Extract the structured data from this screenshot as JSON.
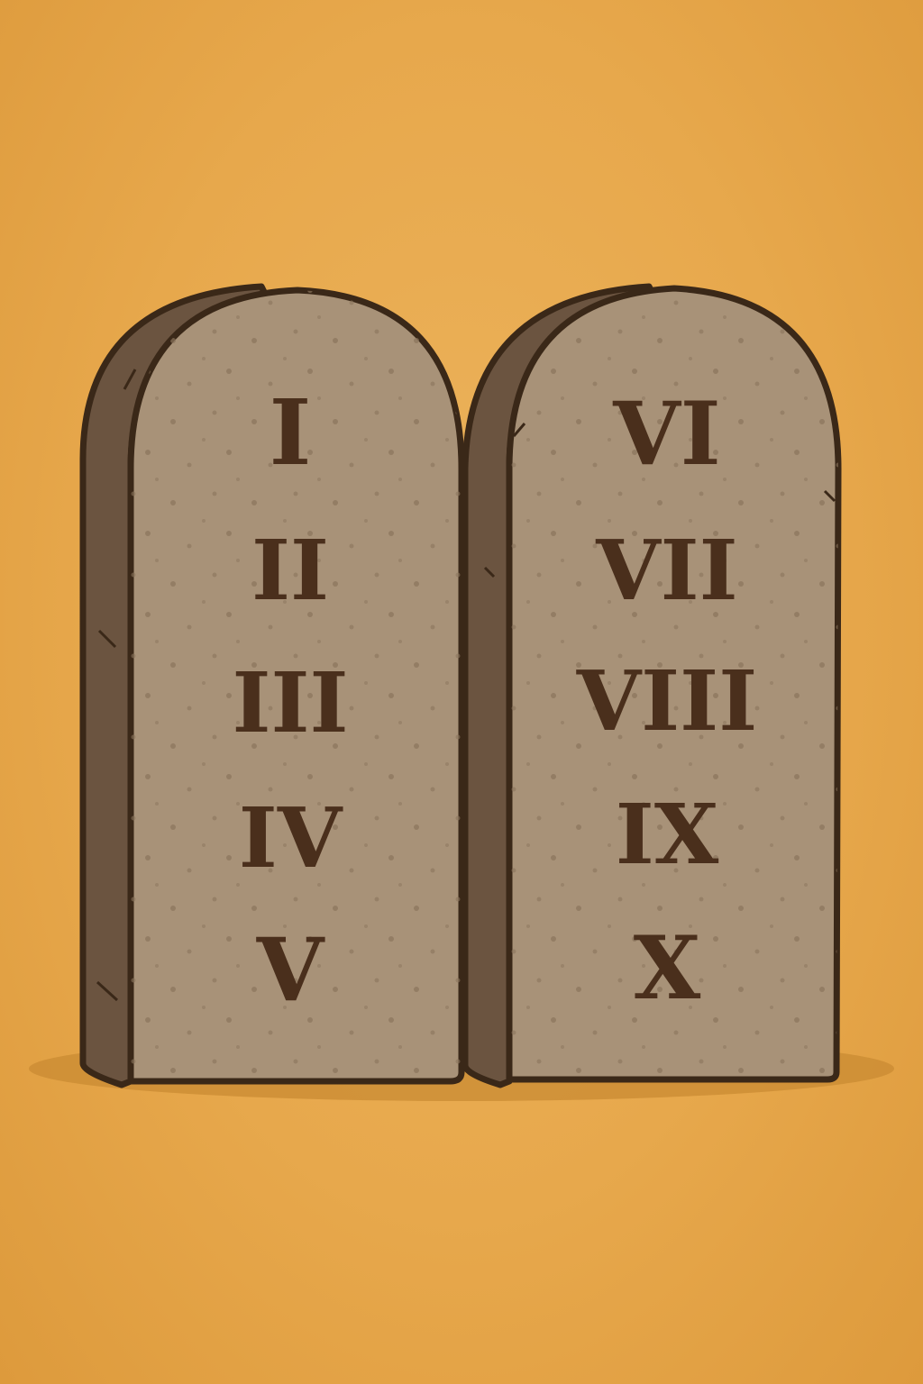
{
  "colors": {
    "background": "#e7a84c",
    "stone_face": "#a89278",
    "stone_side": "#6b5440",
    "outline": "#3a2818",
    "numeral": "#4a2f1c",
    "shadow": "#c98b33"
  },
  "tablets": {
    "left": {
      "numerals": [
        "I",
        "II",
        "III",
        "IV",
        "V"
      ]
    },
    "right": {
      "numerals": [
        "VI",
        "VII",
        "VIII",
        "IX",
        "X"
      ]
    }
  }
}
